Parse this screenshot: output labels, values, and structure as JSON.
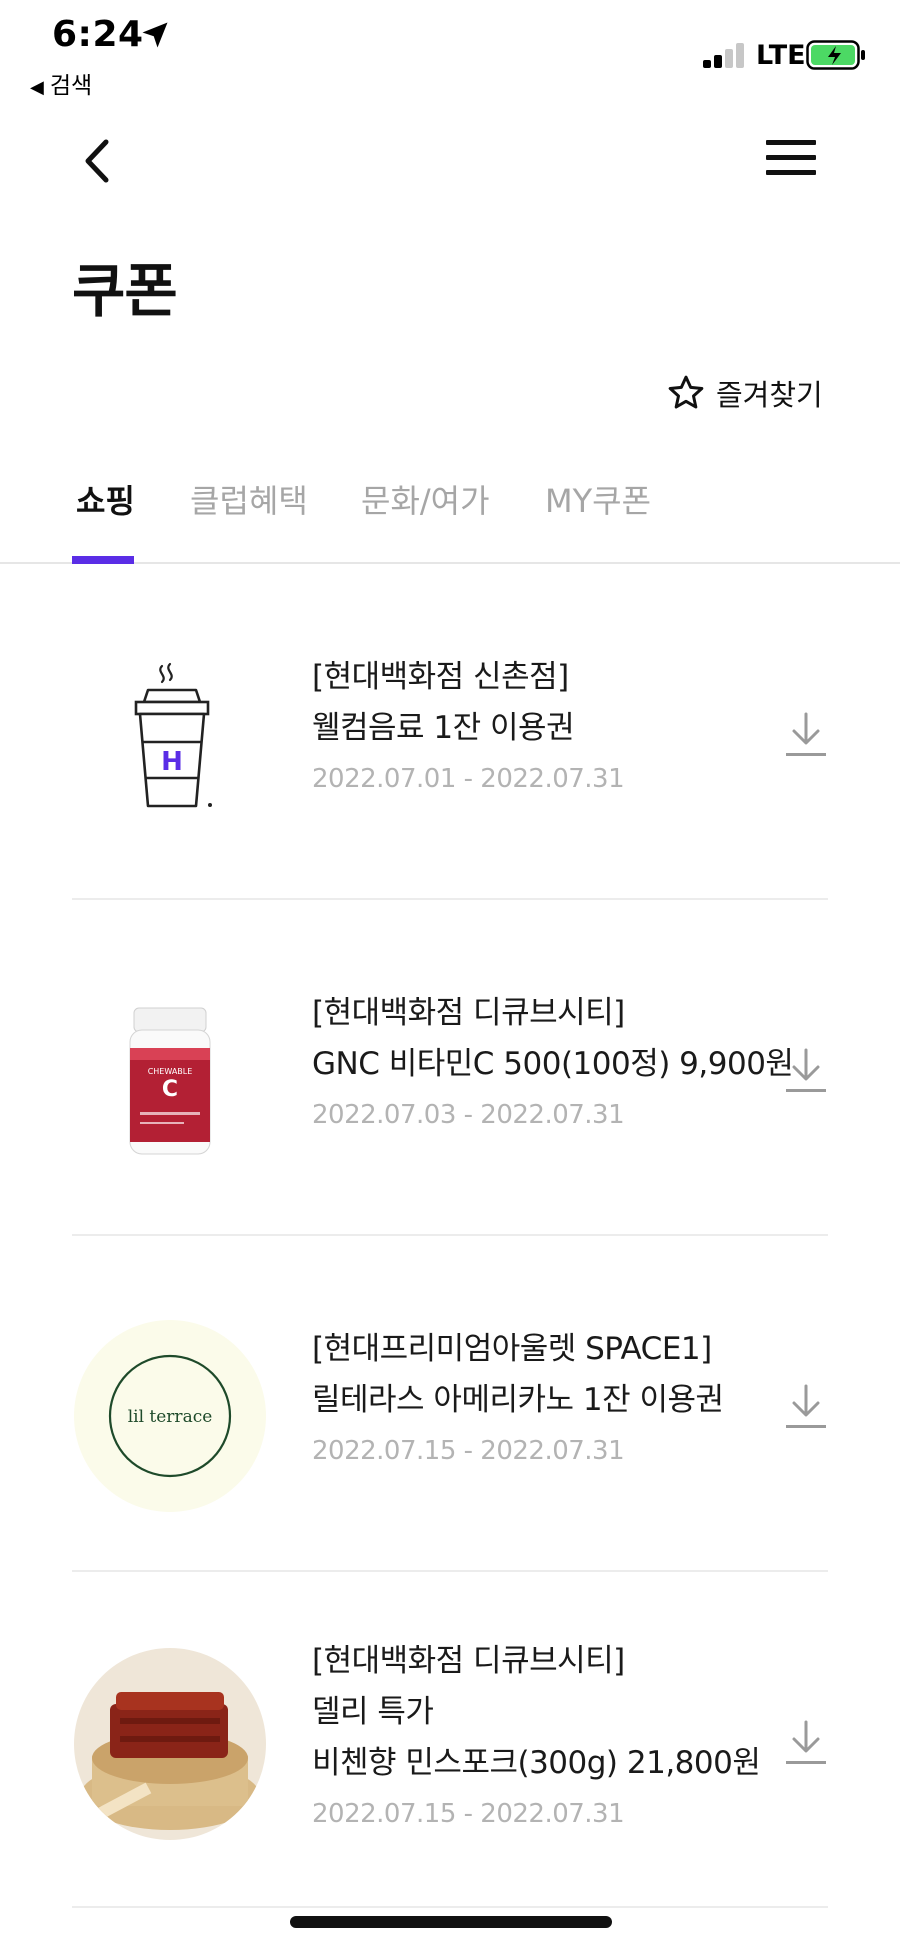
{
  "status_bar": {
    "time": "6:24",
    "back_app": "검색",
    "network": "LTE",
    "battery_color": "#4cd964"
  },
  "header": {
    "title": "쿠폰",
    "favorite_label": "즐겨찾기"
  },
  "tabs": [
    {
      "label": "쇼핑",
      "active": true
    },
    {
      "label": "클럽혜택",
      "active": false
    },
    {
      "label": "문화/여가",
      "active": false
    },
    {
      "label": "MY쿠폰",
      "active": false
    }
  ],
  "accent_color": "#5a2de6",
  "coupons": [
    {
      "store": "[현대백화점 신촌점]",
      "lines": [
        "웰컴음료 1잔 이용권"
      ],
      "period": "2022.07.01 - 2022.07.31",
      "thumb_icon": "coffee-cup-icon",
      "thumb_letter": "H"
    },
    {
      "store": "[현대백화점 디큐브시티]",
      "lines": [
        "GNC 비타민C 500(100정) 9,900원"
      ],
      "period": "2022.07.03 - 2022.07.31",
      "thumb_icon": "vitamin-bottle-icon",
      "thumb_letter": "C"
    },
    {
      "store": "[현대프리미엄아울렛 SPACE1]",
      "lines": [
        "릴테라스 아메리카노 1잔 이용권"
      ],
      "period": "2022.07.15 - 2022.07.31",
      "thumb_icon": "lil-terrace-logo",
      "thumb_letter": "lil terrace"
    },
    {
      "store": "[현대백화점 디큐브시티]",
      "lines": [
        "델리 특가",
        "비첸향 민스포크(300g) 21,800원"
      ],
      "period": "2022.07.15 - 2022.07.31",
      "thumb_icon": "jerky-photo",
      "thumb_letter": ""
    }
  ]
}
